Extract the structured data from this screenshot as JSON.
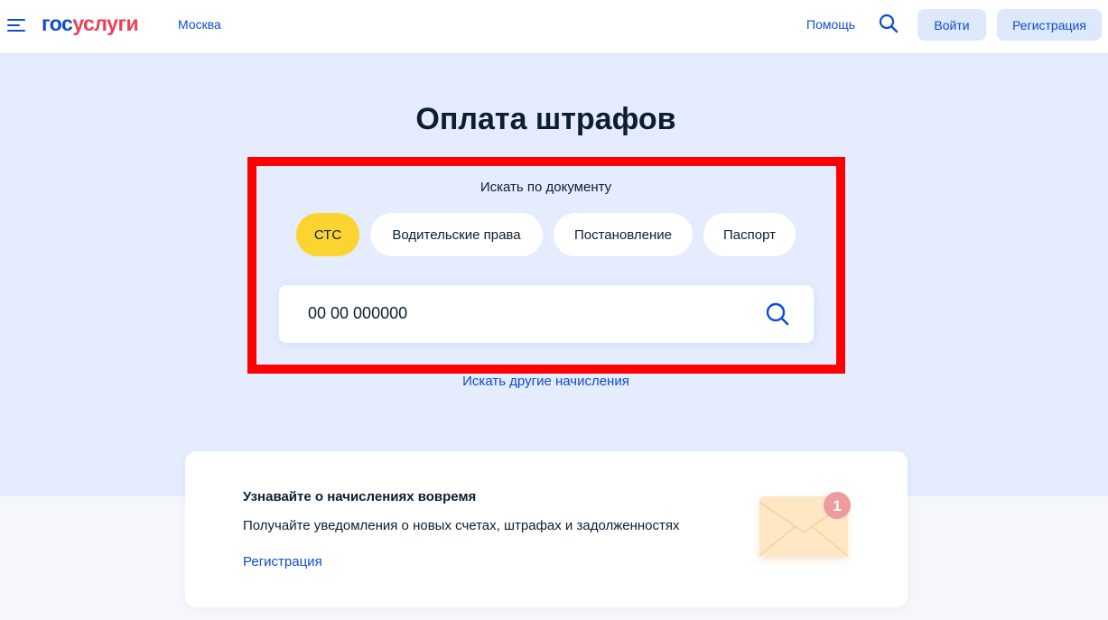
{
  "header": {
    "logo_part1": "гос",
    "logo_part2": "услуги",
    "city": "Москва",
    "help": "Помощь",
    "login": "Войти",
    "register": "Регистрация"
  },
  "main": {
    "title": "Оплата штрафов",
    "search_by_label": "Искать по документу",
    "doc_types": [
      {
        "label": "СТС",
        "active": true
      },
      {
        "label": "Водительские права",
        "active": false
      },
      {
        "label": "Постановление",
        "active": false
      },
      {
        "label": "Паспорт",
        "active": false
      }
    ],
    "input_value": "00 00 000000",
    "other_charges_link": "Искать другие начисления"
  },
  "promo": {
    "title": "Узнавайте о начислениях вовремя",
    "text": "Получайте уведомления о новых счетах, штрафах и задолженностях",
    "link": "Регистрация",
    "badge_count": "1"
  },
  "colors": {
    "brand_blue": "#0d4cd3",
    "brand_red": "#ee3f58",
    "hero_bg": "#e4ecfd",
    "active_chip": "#fcd431",
    "highlight_border": "#ff0000"
  }
}
